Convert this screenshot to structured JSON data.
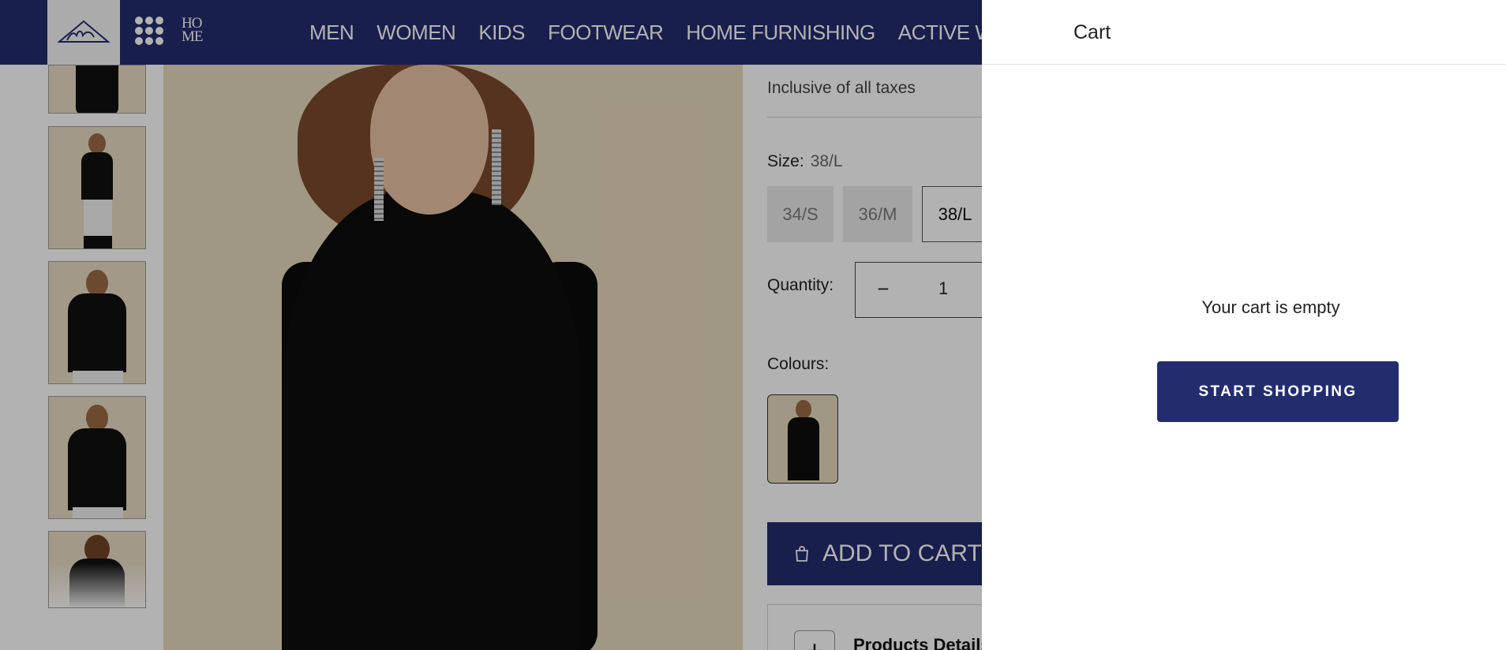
{
  "header": {
    "nav": [
      "MEN",
      "WOMEN",
      "KIDS",
      "FOOTWEAR",
      "HOME FURNISHING",
      "ACTIVE WEAR"
    ],
    "home_mark_top": "HO",
    "home_mark_bottom": "ME",
    "colors": {
      "brand": "#232d6e"
    }
  },
  "product": {
    "tax_note": "Inclusive of all taxes",
    "size_label": "Size:",
    "selected_size": "38/L",
    "sizes": [
      "34/S",
      "36/M",
      "38/L"
    ],
    "quantity_label": "Quantity:",
    "quantity_minus": "−",
    "quantity": "1",
    "colours_label": "Colours:",
    "add_to_cart": "ADD TO CART",
    "products_detail": "Products Details",
    "products_detail_toggle": "+"
  },
  "cart": {
    "title": "Cart",
    "empty_message": "Your cart is empty",
    "cta": "START SHOPPING"
  }
}
